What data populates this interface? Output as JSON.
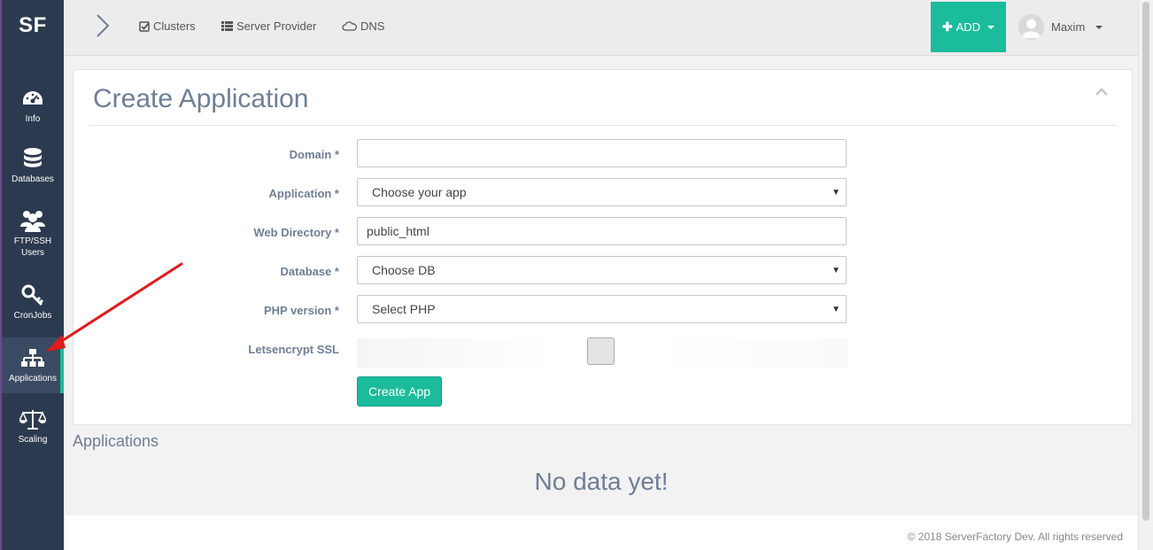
{
  "brand": "SF",
  "sidebar": {
    "items": [
      {
        "label": "Info",
        "icon": "dashboard-icon"
      },
      {
        "label": "Databases",
        "icon": "database-icon"
      },
      {
        "label": "FTP/SSH Users",
        "icon": "users-icon"
      },
      {
        "label": "CronJobs",
        "icon": "key-icon"
      },
      {
        "label": "Applications",
        "icon": "sitemap-icon",
        "active": true
      },
      {
        "label": "Scaling",
        "icon": "scale-icon"
      }
    ]
  },
  "topnav": {
    "links": [
      {
        "label": "Clusters",
        "icon": "check-square-icon"
      },
      {
        "label": "Server Provider",
        "icon": "list-icon"
      },
      {
        "label": "DNS",
        "icon": "cloud-icon"
      }
    ],
    "add_label": "ADD",
    "user_name": "Maxim"
  },
  "card": {
    "title": "Create Application",
    "fields": {
      "domain_label": "Domain *",
      "domain_value": "",
      "application_label": "Application *",
      "application_value": "Choose your app",
      "webdir_label": "Web Directory *",
      "webdir_value": "public_html",
      "database_label": "Database *",
      "database_value": "Choose DB",
      "php_label": "PHP version *",
      "php_value": "Select PHP",
      "ssl_label": "Letsencrypt SSL"
    },
    "submit_label": "Create App"
  },
  "applications": {
    "title": "Applications",
    "empty_message": "No data yet!"
  },
  "footer": "© 2018 ServerFactory Dev. All rights reserved",
  "colors": {
    "sidebar": "#2c3a4f",
    "accent": "#1abc9c",
    "text_muted": "#6f7e95",
    "annotation": "#e01b1b"
  }
}
